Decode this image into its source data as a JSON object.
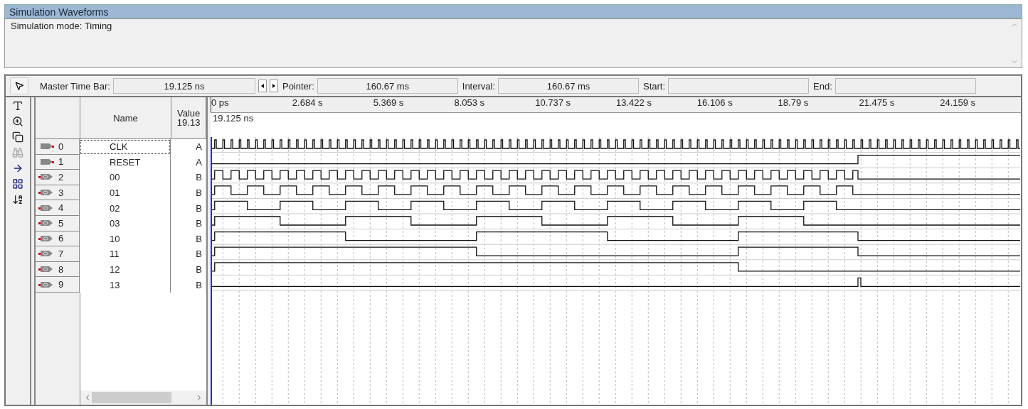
{
  "window": {
    "title": "Simulation Waveforms"
  },
  "mode_text": "Simulation mode: Timing",
  "time_bar": [
    {
      "label": "Master Time Bar:",
      "value": "19.125 ns",
      "kind": "stepper"
    },
    {
      "label": "Pointer:",
      "value": "160.67 ms",
      "kind": "plain"
    },
    {
      "label": "Interval:",
      "value": "160.67 ms",
      "kind": "plain"
    },
    {
      "label": "Start:",
      "kind": "plain"
    },
    {
      "label": "End:",
      "kind": "plain"
    }
  ],
  "table": {
    "columns": [
      {
        "lines": [
          "Name"
        ]
      },
      {
        "lines": [
          "Value",
          "19.13"
        ]
      }
    ],
    "rows": [
      {
        "index": "0",
        "name": "CLK",
        "value": "A",
        "kind": "clock",
        "selected": true
      },
      {
        "index": "1",
        "name": "RESET",
        "value": "A",
        "kind": "reset",
        "selected": false
      },
      {
        "index": "2",
        "name": "00",
        "value": "B",
        "kind": "counter",
        "selected": false
      },
      {
        "index": "3",
        "name": "01",
        "value": "B",
        "kind": "counter",
        "selected": false
      },
      {
        "index": "4",
        "name": "02",
        "value": "B",
        "kind": "counter",
        "selected": false
      },
      {
        "index": "5",
        "name": "03",
        "value": "B",
        "kind": "counter",
        "selected": false
      },
      {
        "index": "6",
        "name": "10",
        "value": "B",
        "kind": "counter",
        "selected": false
      },
      {
        "index": "7",
        "name": "11",
        "value": "B",
        "kind": "counter",
        "selected": false
      },
      {
        "index": "8",
        "name": "12",
        "value": "B",
        "kind": "counter",
        "selected": false
      },
      {
        "index": "9",
        "name": "13",
        "value": "B",
        "kind": "glitch",
        "selected": false
      }
    ]
  },
  "timeline": {
    "ticks": [
      "0 ps",
      "2.684 s",
      "5.369 s",
      "8.053 s",
      "10.737 s",
      "13.422 s",
      "16.106 s",
      "18.79 s",
      "21.475 s",
      "24.159 s"
    ],
    "master_time": "19.125 ns"
  }
}
